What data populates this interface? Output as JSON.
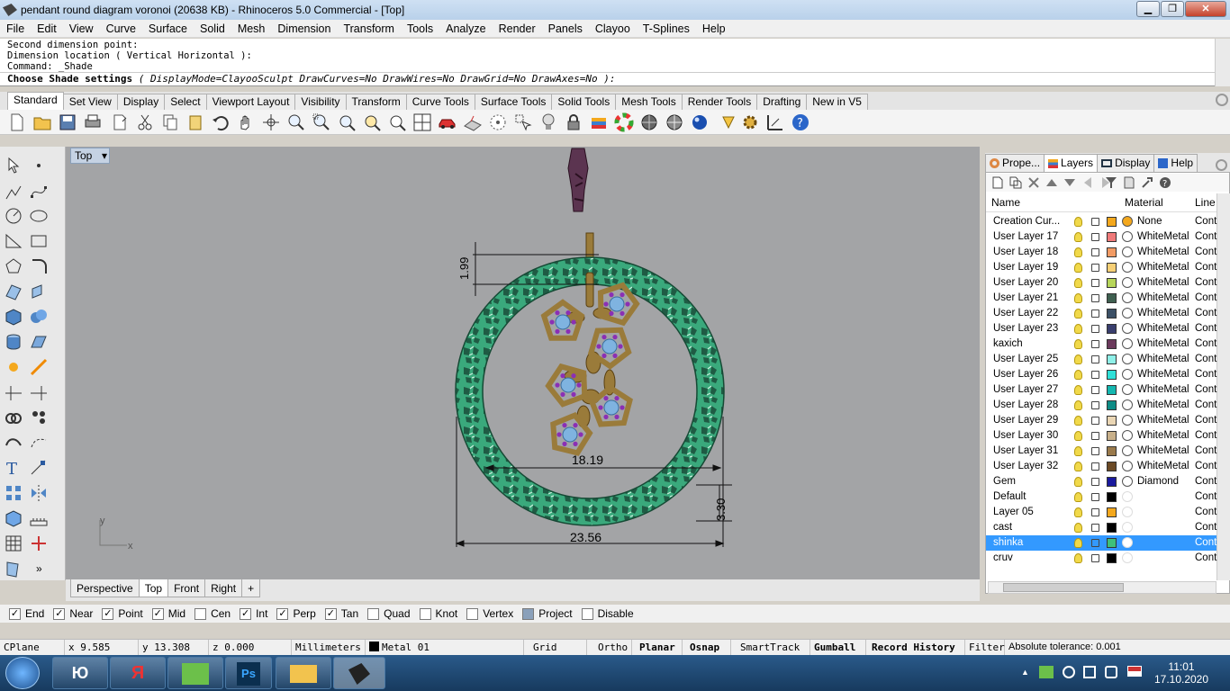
{
  "window": {
    "title": "pendant round diagram voronoi (20638 KB) - Rhinoceros 5.0 Commercial - [Top]",
    "min": "▁",
    "max": "❐",
    "close": "✕"
  },
  "menu": [
    "File",
    "Edit",
    "View",
    "Curve",
    "Surface",
    "Solid",
    "Mesh",
    "Dimension",
    "Transform",
    "Tools",
    "Analyze",
    "Render",
    "Panels",
    "Clayoo",
    "T-Splines",
    "Help"
  ],
  "command": {
    "history": [
      "Second dimension point:",
      "Dimension location ( Vertical  Horizontal ):",
      "Command: _Shade"
    ],
    "prompt": "Choose Shade settings",
    "options": "( DisplayMode=ClayooSculpt  DrawCurves=No  DrawWires=No  DrawGrid=No  DrawAxes=No ):"
  },
  "toolbar_tabs": [
    "Standard",
    "Set View",
    "Display",
    "Select",
    "Viewport Layout",
    "Visibility",
    "Transform",
    "Curve Tools",
    "Surface Tools",
    "Solid Tools",
    "Mesh Tools",
    "Render Tools",
    "Drafting",
    "New in V5"
  ],
  "viewport": {
    "label": "Top",
    "dims": {
      "d1": "1.99",
      "d2": "18.19",
      "d3": "3.30",
      "d4": "23.56"
    },
    "axis_x": "x",
    "axis_y": "y",
    "ring_color": "#3aa97c",
    "metal_color": "#9a7b3a",
    "gem_color": "#7fb3e0",
    "stone_color": "#8b2fb5"
  },
  "viewport_tabs": [
    "Perspective",
    "Top",
    "Front",
    "Right",
    "+"
  ],
  "panel": {
    "tabs": [
      "Prope...",
      "Layers",
      "Display",
      "Help"
    ],
    "columns": {
      "name": "Name",
      "material": "Material",
      "line": "Line"
    },
    "layers": [
      {
        "name": "Creation Cur...",
        "color": "#f4a81d",
        "material": "None",
        "line": "Cont",
        "mc": "#f4a81d"
      },
      {
        "name": "User Layer 17",
        "color": "#f07a7a",
        "material": "WhiteMetal",
        "line": "Cont"
      },
      {
        "name": "User Layer 18",
        "color": "#f29b64",
        "material": "WhiteMetal",
        "line": "Cont"
      },
      {
        "name": "User Layer 19",
        "color": "#f7d076",
        "material": "WhiteMetal",
        "line": "Cont"
      },
      {
        "name": "User Layer 20",
        "color": "#b7d65a",
        "material": "WhiteMetal",
        "line": "Cont"
      },
      {
        "name": "User Layer 21",
        "color": "#3f6050",
        "material": "WhiteMetal",
        "line": "Cont"
      },
      {
        "name": "User Layer 22",
        "color": "#3c5066",
        "material": "WhiteMetal",
        "line": "Cont"
      },
      {
        "name": "User Layer 23",
        "color": "#3a3f6e",
        "material": "WhiteMetal",
        "line": "Cont"
      },
      {
        "name": "kaxich",
        "color": "#6b3a5c",
        "material": "WhiteMetal",
        "line": "Cont"
      },
      {
        "name": "User Layer 25",
        "color": "#8ff0e8",
        "material": "WhiteMetal",
        "line": "Cont"
      },
      {
        "name": "User Layer 26",
        "color": "#2fe0d8",
        "material": "WhiteMetal",
        "line": "Cont"
      },
      {
        "name": "User Layer 27",
        "color": "#14b7b0",
        "material": "WhiteMetal",
        "line": "Cont"
      },
      {
        "name": "User Layer 28",
        "color": "#0e8c86",
        "material": "WhiteMetal",
        "line": "Cont"
      },
      {
        "name": "User Layer 29",
        "color": "#ead6b4",
        "material": "WhiteMetal",
        "line": "Cont"
      },
      {
        "name": "User Layer 30",
        "color": "#c8b08a",
        "material": "WhiteMetal",
        "line": "Cont"
      },
      {
        "name": "User Layer 31",
        "color": "#9a7a4c",
        "material": "WhiteMetal",
        "line": "Cont"
      },
      {
        "name": "User Layer 32",
        "color": "#6b4a26",
        "material": "WhiteMetal",
        "line": "Cont"
      },
      {
        "name": "Gem",
        "color": "#1a1a9e",
        "material": "Diamond",
        "line": "Cont"
      },
      {
        "name": "Default",
        "color": "#000000",
        "material": "",
        "line": "Cont"
      },
      {
        "name": "Layer 05",
        "color": "#f4a81d",
        "material": "",
        "line": "Cont"
      },
      {
        "name": "cast",
        "color": "#000000",
        "material": "",
        "line": "Cont"
      },
      {
        "name": "shinka",
        "color": "#3ec07a",
        "material": "",
        "line": "Cont",
        "selected": true
      },
      {
        "name": "cruv",
        "color": "#000000",
        "material": "",
        "line": "Cont"
      }
    ]
  },
  "osnap": [
    {
      "label": "End",
      "checked": true
    },
    {
      "label": "Near",
      "checked": true
    },
    {
      "label": "Point",
      "checked": true
    },
    {
      "label": "Mid",
      "checked": true
    },
    {
      "label": "Cen",
      "checked": false
    },
    {
      "label": "Int",
      "checked": true
    },
    {
      "label": "Perp",
      "checked": true
    },
    {
      "label": "Tan",
      "checked": true
    },
    {
      "label": "Quad",
      "checked": false
    },
    {
      "label": "Knot",
      "checked": false
    },
    {
      "label": "Vertex",
      "checked": false
    },
    {
      "label": "Project",
      "checked": false
    },
    {
      "label": "Disable",
      "checked": false
    }
  ],
  "status": {
    "cplane": "CPlane",
    "x": "x 9.585",
    "y": "y 13.308",
    "z": "z 0.000",
    "units": "Millimeters",
    "layer": "Metal 01",
    "grid_snap": "Grid Snap",
    "ortho": "Ortho",
    "planar": "Planar",
    "osnap": "Osnap",
    "smarttrack": "SmartTrack",
    "gumball": "Gumball",
    "record_history": "Record History",
    "filter": "Filter",
    "tolerance": "Absolute tolerance: 0.001"
  },
  "taskbar": {
    "time": "11:01",
    "date": "17.10.2020",
    "ya": "Я",
    "yu": "Ю",
    "ps": "Ps"
  }
}
